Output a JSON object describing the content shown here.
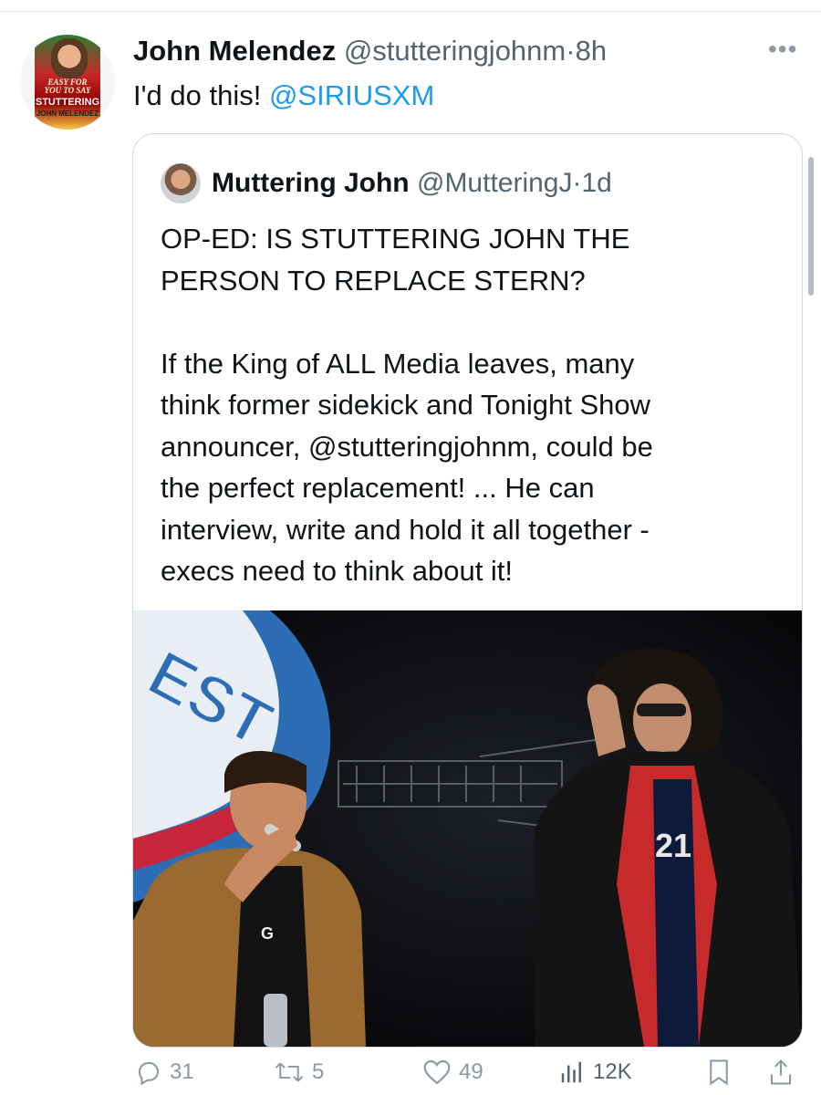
{
  "tweet": {
    "avatar": {
      "book_title_line1": "EASY FOR",
      "book_title_line2": "YOU TO SAY",
      "book_title_line3": "STUTTERING",
      "book_author": "JOHN MELENDEZ"
    },
    "author_name": "John Melendez",
    "author_handle": "@stutteringjohnm",
    "separator": "·",
    "time_ago": "8h",
    "text_prefix": "I'd do this! ",
    "text_mention": "@SIRIUSXM",
    "more_icon": "more-horizontal-icon"
  },
  "quoted_tweet": {
    "author_name": "Muttering John",
    "author_handle": "@MutteringJ",
    "separator": "·",
    "time_ago": "1d",
    "headline_line1": "OP-ED: IS STUTTERING JOHN THE",
    "headline_line2": "PERSON TO REPLACE STERN?",
    "body_lines": [
      "If the King of ALL Media leaves, many",
      "think former sidekick and Tonight Show",
      "announcer, @stutteringjohnm, could be",
      "the perfect replacement! ... He can",
      "interview, write and hold it all together -",
      "execs need to think about it!"
    ],
    "photo": {
      "banner_text": "EST",
      "shirt_text": "21"
    }
  },
  "actions": {
    "reply_count": "31",
    "retweet_count": "5",
    "like_count": "49",
    "view_count": "12K"
  },
  "colors": {
    "accent": "#1d9bf0",
    "text_primary": "#0f1419",
    "text_secondary": "#536471",
    "border": "#cfd9de"
  }
}
